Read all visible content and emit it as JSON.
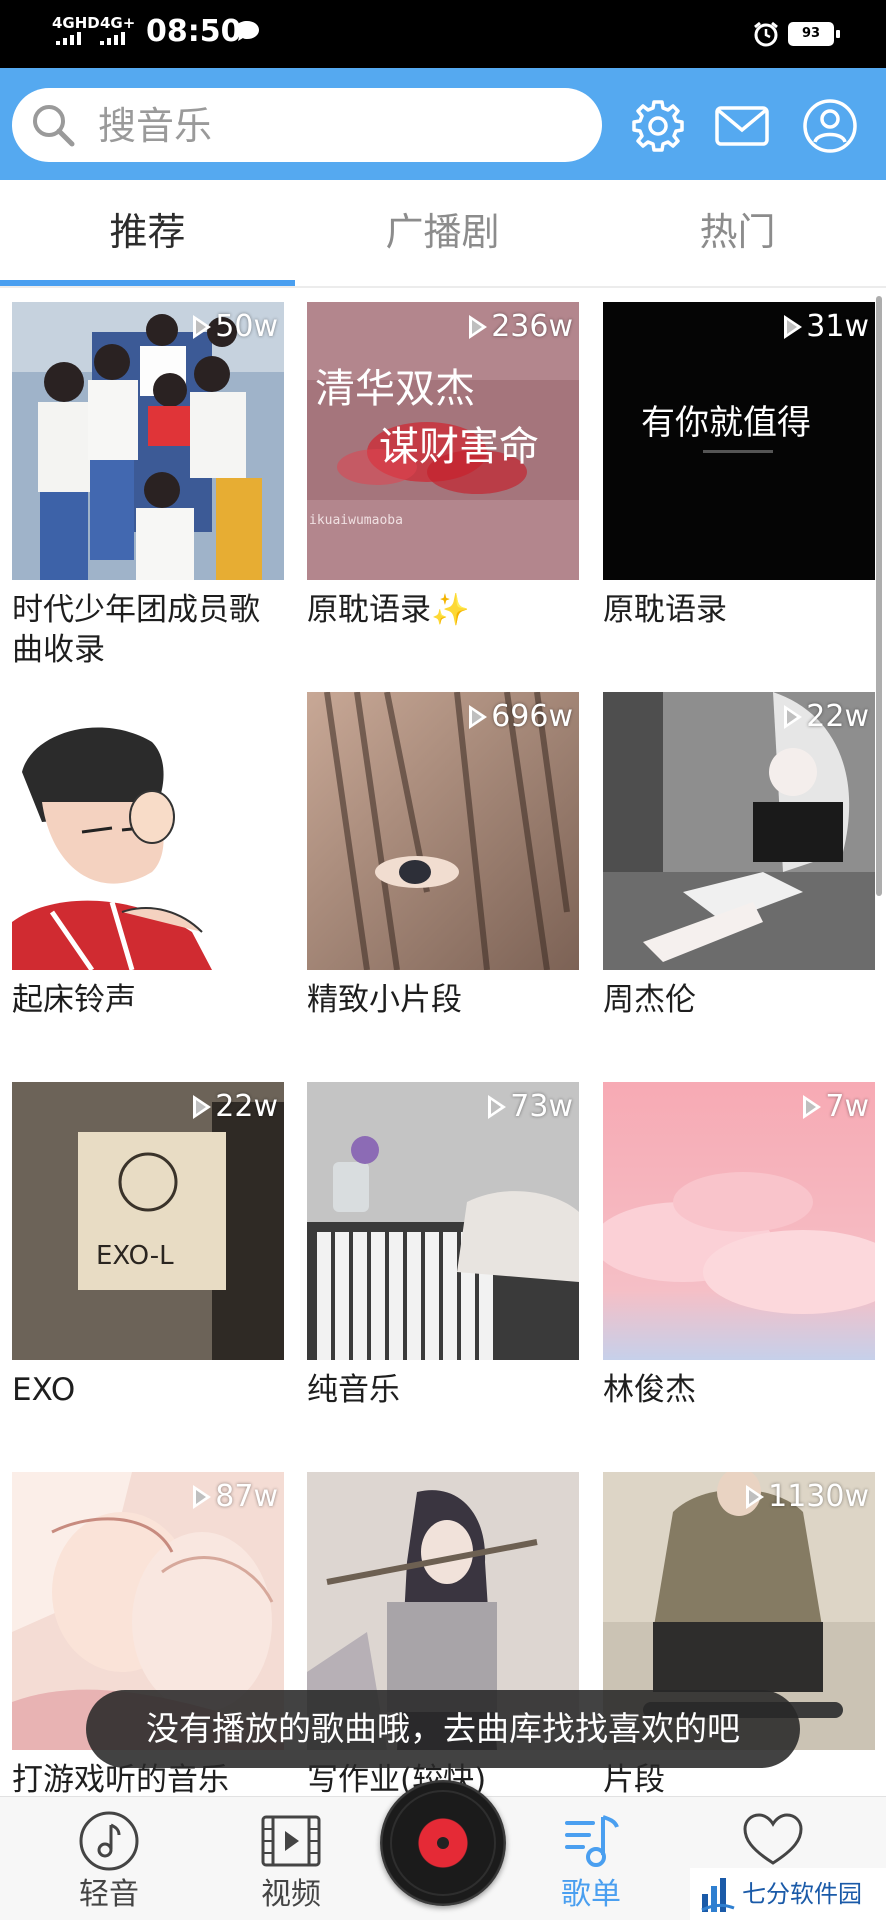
{
  "status_bar": {
    "net1": "4GHD",
    "net2": "4G+",
    "time": "08:50",
    "battery": "93"
  },
  "search": {
    "placeholder": "搜音乐"
  },
  "header": {
    "icons": [
      "gear-icon",
      "mail-icon",
      "user-icon"
    ]
  },
  "tabs": [
    {
      "label": "推荐",
      "active": true
    },
    {
      "label": "广播剧",
      "active": false
    },
    {
      "label": "热门",
      "active": false
    }
  ],
  "cards": [
    {
      "title": "时代少年团成员歌曲收录",
      "plays": "50w",
      "cover": "#8ea7c4"
    },
    {
      "title": "原耽语录✨",
      "plays": "236w",
      "cover": "#b5878e"
    },
    {
      "title": "原耽语录",
      "plays": "31w",
      "cover": "#050505"
    },
    {
      "title": "起床铃声",
      "plays": "",
      "cover": "#ffffff"
    },
    {
      "title": "精致小片段",
      "plays": "696w",
      "cover": "#a48a7c"
    },
    {
      "title": "周杰伦",
      "plays": "22w",
      "cover": "#8d8d8d"
    },
    {
      "title": "EXO",
      "plays": "22w",
      "cover": "#6e6558"
    },
    {
      "title": "纯音乐",
      "plays": "73w",
      "cover": "#bcbcbc"
    },
    {
      "title": "林俊杰",
      "plays": "7w",
      "cover": "#f4b7bf"
    },
    {
      "title": "打游戏听的音乐",
      "plays": "87w",
      "cover": "#f2d2cb"
    },
    {
      "title": "写作业(较快)",
      "plays": "",
      "cover": "#d9d3cf"
    },
    {
      "title": "片段",
      "plays": "1130w",
      "cover": "#c9bea6"
    }
  ],
  "cover_texts": {
    "card2_line1": "清华双杰",
    "card2_line2": "谋财害命",
    "card2_small": "ikuaiwumaoba",
    "card3_text": "有你就值得",
    "card7_sign": "EXO-L"
  },
  "toast": "没有播放的歌曲哦，去曲库找找喜欢的吧",
  "bottom_nav": [
    {
      "label": "轻音",
      "icon": "music-note-icon",
      "active": false
    },
    {
      "label": "视频",
      "icon": "video-icon",
      "active": false
    },
    {
      "label": "歌单",
      "icon": "playlist-icon",
      "active": true
    },
    {
      "label": "",
      "icon": "heart-icon",
      "active": false
    }
  ],
  "watermark": "七分软件园",
  "colors": {
    "header_bg": "#55a9f0",
    "accent": "#4a9ff0",
    "disc_red": "#e52a36"
  }
}
